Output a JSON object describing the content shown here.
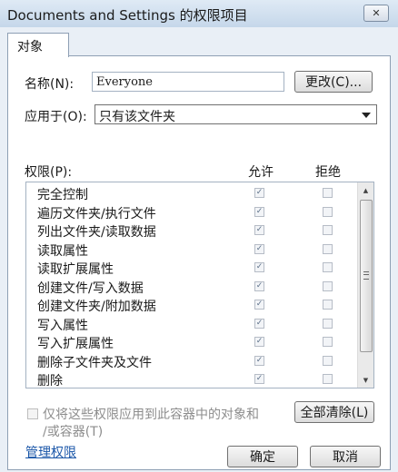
{
  "window": {
    "title": "Documents and Settings 的权限项目",
    "close_glyph": "✕"
  },
  "tab": {
    "label": "对象"
  },
  "name_field": {
    "label": "名称(N):",
    "value": "Everyone",
    "change_button": "更改(C)..."
  },
  "apply_to": {
    "label": "应用于(O):",
    "selected": "只有该文件夹"
  },
  "permissions": {
    "header": "权限(P):",
    "allow_header": "允许",
    "deny_header": "拒绝",
    "rows": [
      {
        "name": "完全控制",
        "allow": true,
        "deny": false
      },
      {
        "name": "遍历文件夹/执行文件",
        "allow": true,
        "deny": false
      },
      {
        "name": "列出文件夹/读取数据",
        "allow": true,
        "deny": false
      },
      {
        "name": "读取属性",
        "allow": true,
        "deny": false
      },
      {
        "name": "读取扩展属性",
        "allow": true,
        "deny": false
      },
      {
        "name": "创建文件/写入数据",
        "allow": true,
        "deny": false
      },
      {
        "name": "创建文件夹/附加数据",
        "allow": true,
        "deny": false
      },
      {
        "name": "写入属性",
        "allow": true,
        "deny": false
      },
      {
        "name": "写入扩展属性",
        "allow": true,
        "deny": false
      },
      {
        "name": "删除子文件夹及文件",
        "allow": true,
        "deny": false
      },
      {
        "name": "删除",
        "allow": true,
        "deny": false
      }
    ]
  },
  "inherit_checkbox": {
    "line1": "仅将这些权限应用到此容器中的对象和",
    "line2": "/或容器(T)"
  },
  "clear_all_button": "全部清除(L)",
  "manage_link": "管理权限",
  "footer": {
    "ok": "确定",
    "cancel": "取消"
  },
  "colors": {
    "accent_link": "#1a56a8",
    "title_bg": "#c5d7ea"
  }
}
